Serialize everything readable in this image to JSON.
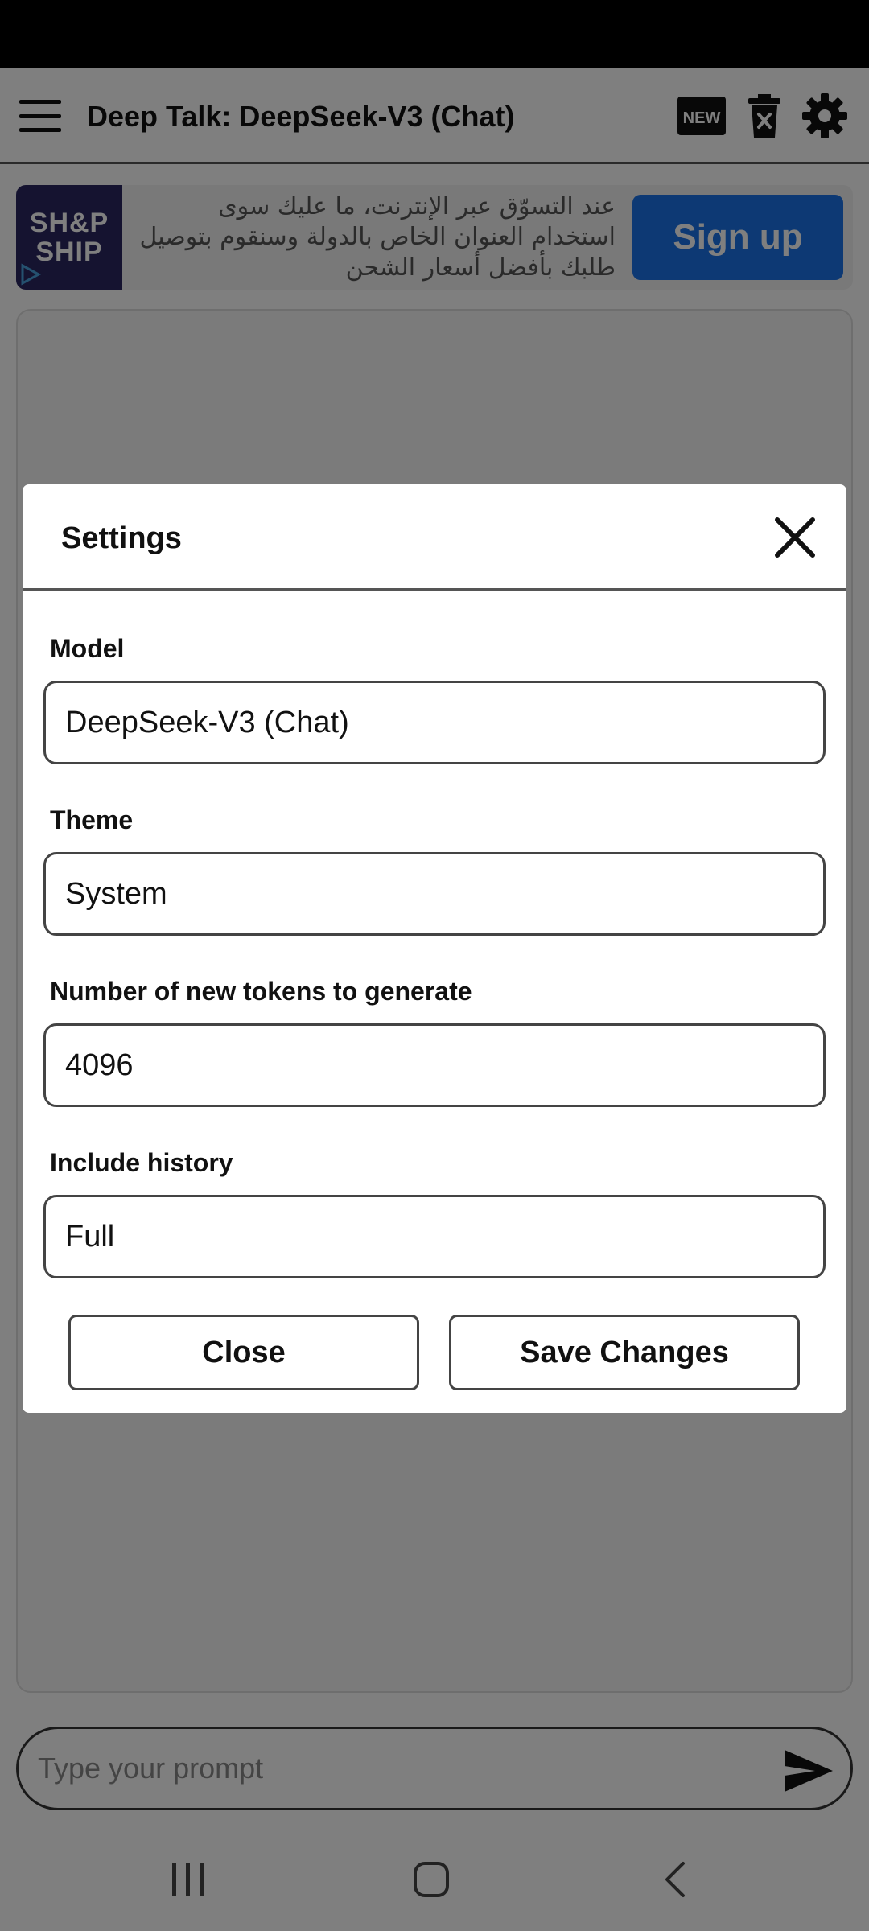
{
  "app": {
    "title": "Deep Talk: DeepSeek-V3 (Chat)",
    "new_badge": "NEW"
  },
  "ad": {
    "logo_text": "SH&P\nSHIP",
    "text": "عند التسوّق عبر الإنترنت، ما عليك سوى استخدام العنوان الخاص بالدولة وسنقوم بتوصيل طلبك بأفضل أسعار الشحن",
    "cta_label": "Sign up"
  },
  "prompt": {
    "placeholder": "Type your prompt"
  },
  "settings_modal": {
    "title": "Settings",
    "fields": [
      {
        "label": "Model",
        "value": "DeepSeek-V3 (Chat)"
      },
      {
        "label": "Theme",
        "value": "System"
      },
      {
        "label": "Number of new tokens to generate",
        "value": "4096"
      },
      {
        "label": "Include history",
        "value": "Full"
      }
    ],
    "close_label": "Close",
    "save_label": "Save Changes"
  },
  "colors": {
    "accent": "#1a73e8",
    "ad_logo_bg": "#2a2660",
    "overlay": "rgba(0,0,0,0.5)"
  }
}
